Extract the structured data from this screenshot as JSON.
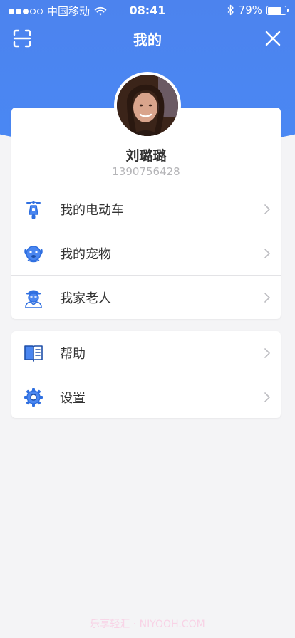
{
  "status_bar": {
    "carrier": "中国移动",
    "time": "08:41",
    "battery": "79%",
    "battery_level": 0.79,
    "signal_bars": 3
  },
  "nav": {
    "title": "我的"
  },
  "profile": {
    "name": "刘璐璐",
    "phone": "1390756428"
  },
  "menu_group_1": [
    {
      "label": "我的电动车",
      "icon": "scooter-icon"
    },
    {
      "label": "我的宠物",
      "icon": "dog-icon"
    },
    {
      "label": "我家老人",
      "icon": "elder-icon"
    }
  ],
  "menu_group_2": [
    {
      "label": "帮助",
      "icon": "book-icon"
    },
    {
      "label": "设置",
      "icon": "gear-icon"
    }
  ],
  "watermark": "乐享轻汇 · NIYOOH.COM",
  "colors": {
    "primary": "#4a86f0",
    "icon_blue": "#3f7be6",
    "background": "#f4f4f6"
  }
}
